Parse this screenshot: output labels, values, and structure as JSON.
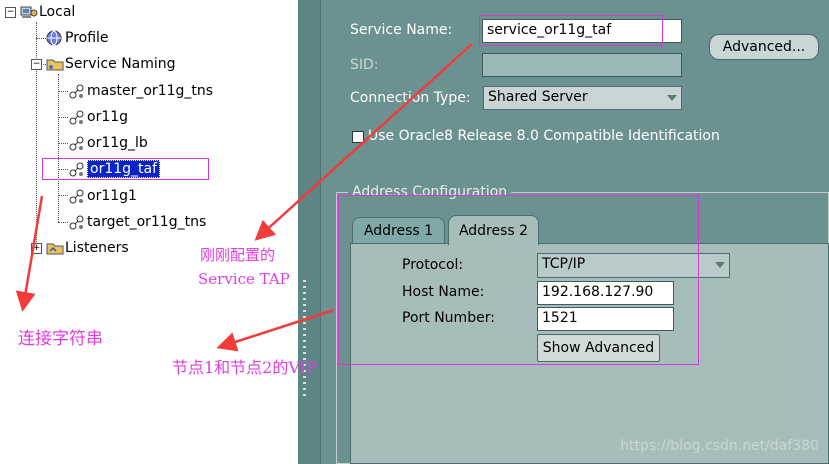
{
  "tree": {
    "root": "Local",
    "items": [
      {
        "label": "Profile"
      },
      {
        "label": "Service Naming"
      },
      {
        "label": "master_or11g_tns"
      },
      {
        "label": "or11g"
      },
      {
        "label": "or11g_lb"
      },
      {
        "label": "or11g_taf"
      },
      {
        "label": "or11g1"
      },
      {
        "label": "target_or11g_tns"
      },
      {
        "label": "Listeners"
      }
    ]
  },
  "form": {
    "service_name_label": "Service Name:",
    "service_name_value": "service_or11g_taf",
    "sid_label": "SID:",
    "sid_value": "",
    "advanced_button": "Advanced...",
    "connection_type_label": "Connection Type:",
    "connection_type_value": "Shared Server",
    "compat_checkbox_label": "Use Oracle8 Release 8.0 Compatible Identification"
  },
  "address": {
    "group_title": "Address Configuration",
    "tabs": [
      {
        "label": "Address 1"
      },
      {
        "label": "Address 2"
      }
    ],
    "active_tab": "Address 2",
    "protocol_label": "Protocol:",
    "protocol_value": "TCP/IP",
    "host_label": "Host Name:",
    "host_value": "192.168.127.90",
    "port_label": "Port Number:",
    "port_value": "1521",
    "show_advanced_button": "Show Advanced"
  },
  "annotations": {
    "taf_line1": "刚刚配置的",
    "taf_line2": "Service TAP",
    "conn_string": "连接字符串",
    "vip": "节点1和节点2的VIP"
  },
  "watermark": "https://blog.csdn.net/daf380",
  "colors": {
    "panel": "#6b9291",
    "annotation": "#e23de2",
    "arrow": "#f23b3b",
    "selection": "#0a24c8"
  }
}
